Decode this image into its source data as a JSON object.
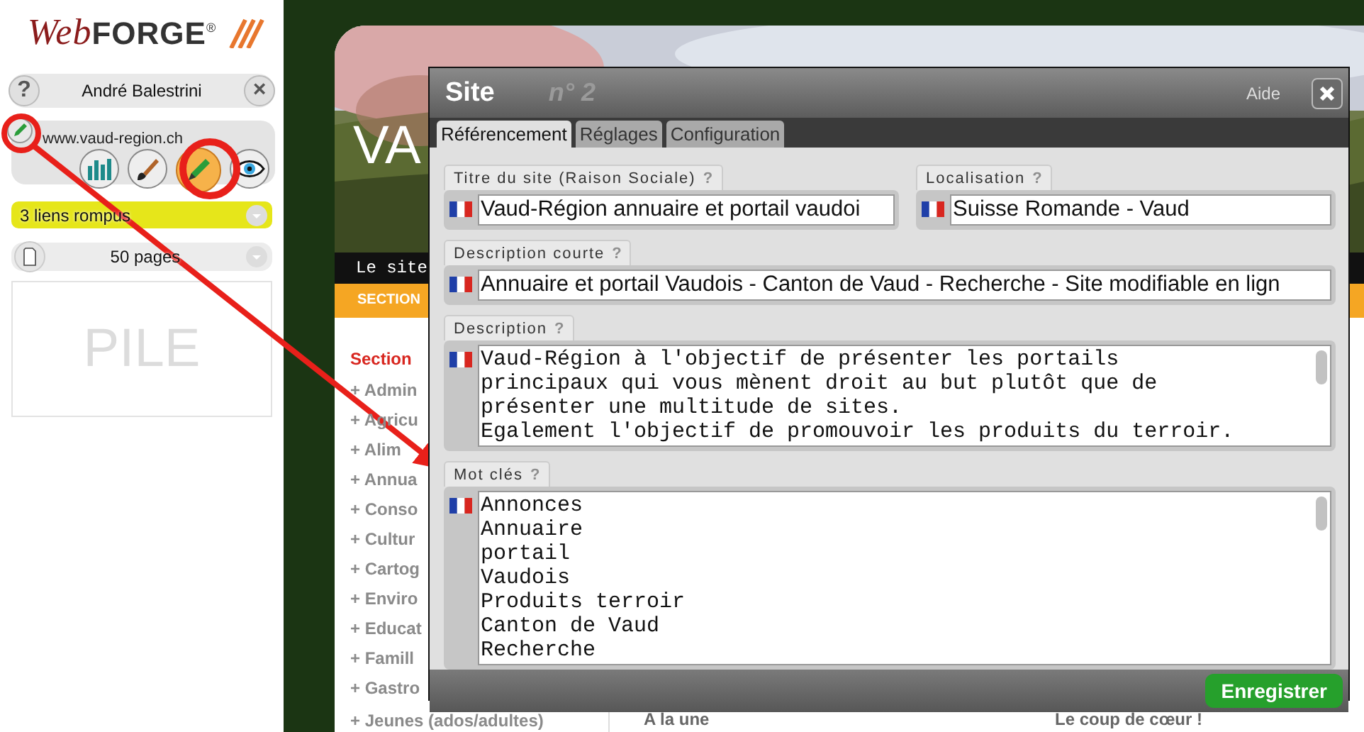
{
  "sidebar": {
    "logo": {
      "script": "Web",
      "main": "FORGE",
      "mark": "®"
    },
    "help": "?",
    "user": "André Balestrini",
    "close": "×",
    "site": {
      "url": "www.vaud-region.ch",
      "tools": [
        {
          "kind": "stats",
          "selected": false
        },
        {
          "kind": "brush",
          "selected": false
        },
        {
          "kind": "pencil",
          "selected": true
        },
        {
          "kind": "eye",
          "selected": false
        }
      ]
    },
    "alert": "3 liens rompus",
    "pages": "50 pages",
    "pile": "PILE"
  },
  "website": {
    "title": "VA",
    "tagline": "Le site",
    "nav": "SECTION",
    "section_heading": "Section",
    "categories": [
      "+ Admin",
      "+ Agricu",
      "+ Alim",
      "+ Annua",
      "+ Conso",
      "+ Cultur",
      "+ Cartog",
      "+ Enviro",
      "+ Educat",
      "+ Famill",
      "+ Gastro",
      "+ Jeunes (ados/adultes)"
    ],
    "headlines": [
      "A la une",
      "Le coup de cœur !"
    ]
  },
  "dialog": {
    "title": "Site",
    "number": "n° 2",
    "help": "Aide",
    "tabs": [
      {
        "label": "Référencement",
        "selected": true
      },
      {
        "label": "Réglages",
        "selected": false
      },
      {
        "label": "Configuration",
        "selected": false
      }
    ],
    "rows": [
      [
        {
          "kind": "line",
          "label": "Titre du site (Raison Sociale)",
          "hint": "?",
          "lines": [
            "Vaud-Région annuaire et portail vaudoi"
          ]
        },
        {
          "kind": "line",
          "label": "Localisation",
          "hint": "?",
          "lines": [
            "Suisse Romande - Vaud"
          ]
        }
      ],
      [
        {
          "kind": "line",
          "label": "Description courte",
          "hint": "?",
          "lines": [
            "Annuaire et portail Vaudois - Canton de Vaud - Recherche - Site modifiable en lign"
          ]
        }
      ],
      [
        {
          "kind": "text",
          "label": "Description",
          "hint": "?",
          "lines": [
            "Vaud-Région à l'objectif de présenter les portails",
            "principaux qui vous mènent droit au but plutôt que de",
            "présenter une multitude de sites.",
            "Egalement l'objectif de promouvoir les produits du terroir."
          ]
        }
      ],
      [
        {
          "kind": "text",
          "label": "Mot clés",
          "hint": "?",
          "lines": [
            "Annonces",
            "Annuaire",
            "portail",
            "Vaudois",
            "Produits terroir",
            "Canton de Vaud",
            "Recherche"
          ]
        }
      ]
    ],
    "save": "Enregistrer"
  }
}
